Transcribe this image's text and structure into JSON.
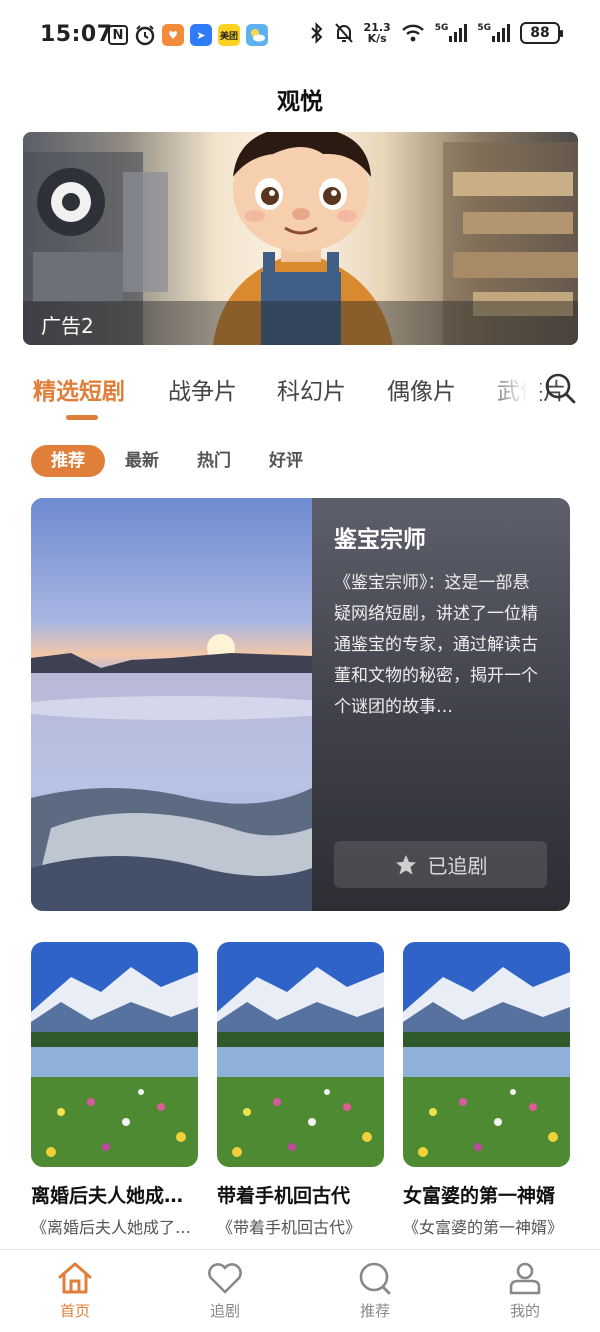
{
  "status_bar": {
    "time": "15:07",
    "net_speed_value": "21.3",
    "net_speed_unit": "K/s",
    "network_1": "5G",
    "network_2": "5G",
    "battery": "88",
    "left_icons": [
      "nfc-icon",
      "alarm-icon",
      "app-heart-icon",
      "app-arrow-icon",
      "meituan-icon",
      "weather-icon"
    ],
    "meituan_label": "美团"
  },
  "header": {
    "title": "观悦"
  },
  "banner": {
    "caption": "广告2"
  },
  "category_tabs": [
    {
      "label": "精选短剧",
      "active": true
    },
    {
      "label": "战争片",
      "active": false
    },
    {
      "label": "科幻片",
      "active": false
    },
    {
      "label": "偶像片",
      "active": false
    },
    {
      "label": "武侠片",
      "active": false
    }
  ],
  "sort_chips": [
    {
      "label": "推荐",
      "active": true
    },
    {
      "label": "最新",
      "active": false
    },
    {
      "label": "热门",
      "active": false
    },
    {
      "label": "好评",
      "active": false
    }
  ],
  "featured": {
    "title": "鉴宝宗师",
    "description": "《鉴宝宗师》：这是一部悬疑网络短剧，讲述了一位精通鉴宝的专家，通过解读古董和文物的秘密，揭开一个个谜团的故事…",
    "follow_label": "已追剧"
  },
  "dramas": [
    {
      "title": "离婚后夫人她成了大佬",
      "subtitle": "《离婚后夫人她成了大佬》"
    },
    {
      "title": "带着手机回古代",
      "subtitle": "《带着手机回古代》"
    },
    {
      "title": "女富婆的第一神婿",
      "subtitle": "《女富婆的第一神婿》"
    }
  ],
  "bottom_nav": [
    {
      "label": "首页",
      "icon": "home-icon",
      "active": true
    },
    {
      "label": "追剧",
      "icon": "heart-icon",
      "active": false
    },
    {
      "label": "推荐",
      "icon": "search-icon",
      "active": false
    },
    {
      "label": "我的",
      "icon": "user-icon",
      "active": false
    }
  ],
  "colors": {
    "accent": "#e07f3a",
    "text": "#222222",
    "muted": "#888888"
  }
}
